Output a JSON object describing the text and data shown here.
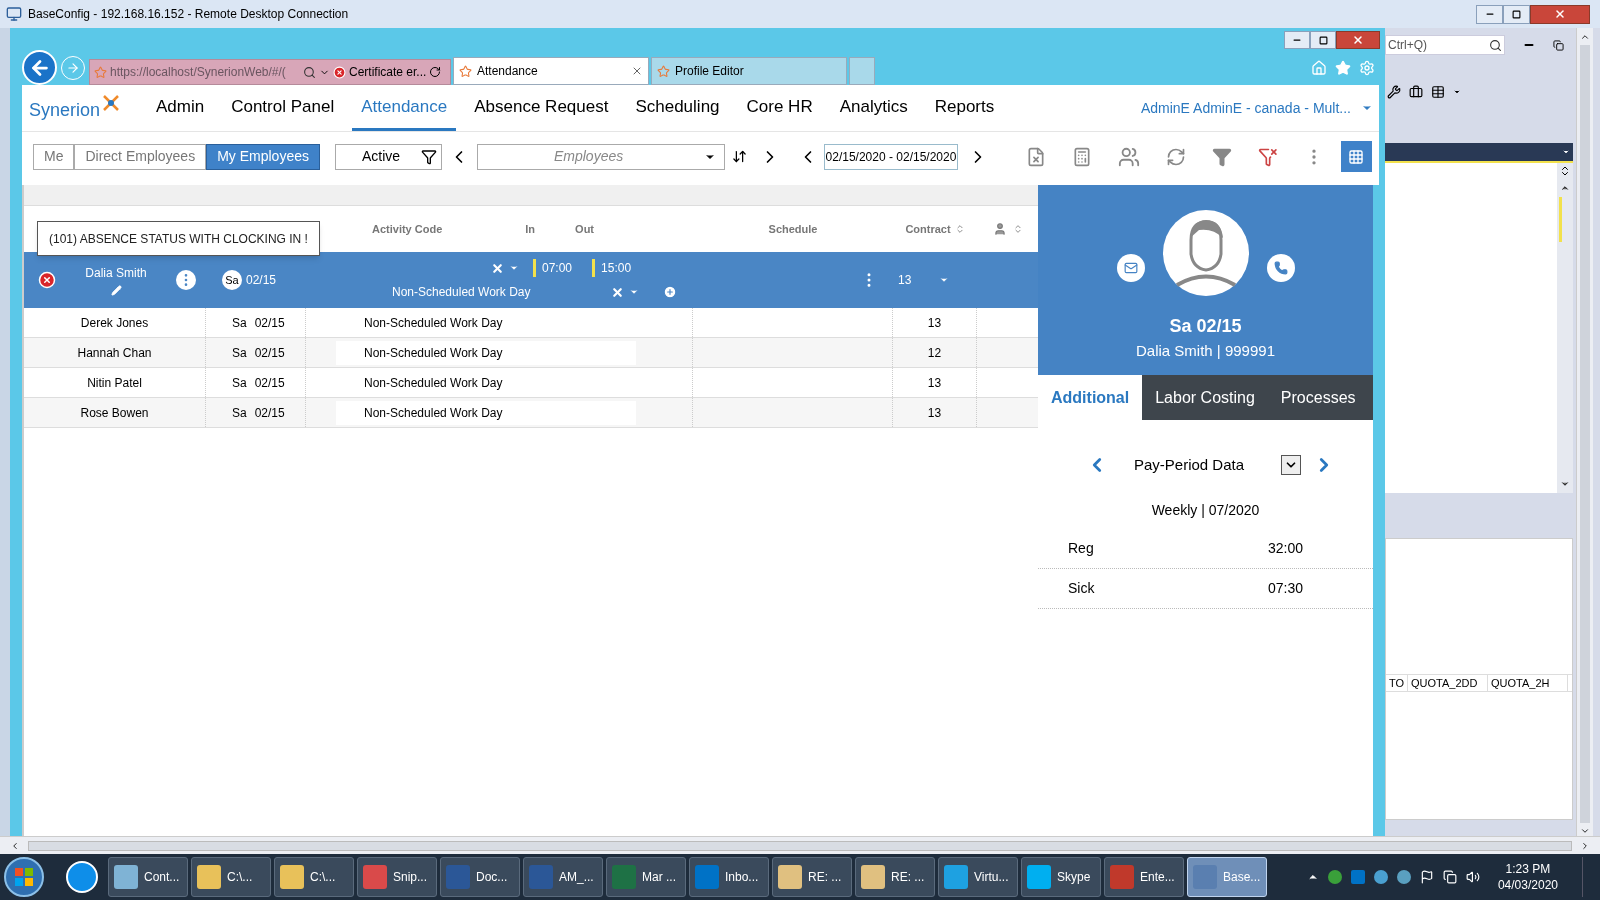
{
  "rdp": {
    "title": "BaseConfig - 192.168.16.152 - Remote Desktop Connection"
  },
  "browser": {
    "address": "https://localhost/SynerionWeb/#/(",
    "certificate": "Certificate er...",
    "tabs": [
      {
        "label": "Attendance",
        "selected": true
      },
      {
        "label": "Profile Editor",
        "selected": false
      }
    ]
  },
  "app": {
    "logo": "Synerion",
    "menu": [
      {
        "label": "Admin",
        "selected": false
      },
      {
        "label": "Control Panel",
        "selected": false
      },
      {
        "label": "Attendance",
        "selected": true
      },
      {
        "label": "Absence Request",
        "selected": false
      },
      {
        "label": "Scheduling",
        "selected": false
      },
      {
        "label": "Core HR",
        "selected": false
      },
      {
        "label": "Analytics",
        "selected": false
      },
      {
        "label": "Reports",
        "selected": false
      }
    ],
    "user": "AdminE AdminE - canada - Mult..."
  },
  "toolbar": {
    "scope": [
      {
        "label": "Me",
        "selected": false
      },
      {
        "label": "Direct Employees",
        "selected": false
      },
      {
        "label": "My Employees",
        "selected": true
      }
    ],
    "status": "Active",
    "employees_placeholder": "Employees",
    "date_range": "02/15/2020 - 02/15/2020"
  },
  "table": {
    "headers": {
      "activity": "Activity Code",
      "in": "In",
      "out": "Out",
      "schedule": "Schedule",
      "contract": "Contract"
    },
    "tooltip": "(101) ABSENCE STATUS WITH CLOCKING IN !",
    "rows": [
      {
        "name": "Dalia Smith",
        "day": "Sa",
        "date": "02/15",
        "activity": "Non-Scheduled Work Day",
        "in": "07:00",
        "out": "15:00",
        "contract": "13",
        "selected": true,
        "error": true
      },
      {
        "name": "Derek Jones",
        "day": "Sa",
        "date": "02/15",
        "activity": "Non-Scheduled Work Day",
        "contract": "13",
        "selected": false,
        "error": false
      },
      {
        "name": "Hannah Chan",
        "day": "Sa",
        "date": "02/15",
        "activity": "Non-Scheduled Work Day",
        "contract": "12",
        "selected": false,
        "error": false
      },
      {
        "name": "Nitin Patel",
        "day": "Sa",
        "date": "02/15",
        "activity": "Non-Scheduled Work Day",
        "contract": "13",
        "selected": false,
        "error": false
      },
      {
        "name": "Rose Bowen",
        "day": "Sa",
        "date": "02/15",
        "activity": "Non-Scheduled Work Day",
        "contract": "13",
        "selected": false,
        "error": false
      }
    ]
  },
  "details": {
    "date": "Sa 02/15",
    "employee": "Dalia Smith | 999991",
    "tabs": [
      {
        "label": "Additional",
        "selected": true
      },
      {
        "label": "Labor Costing",
        "selected": false
      },
      {
        "label": "Processes",
        "selected": false
      }
    ],
    "section": "Pay-Period Data",
    "period": "Weekly | 07/2020",
    "rows": [
      {
        "label": "Reg",
        "value": "32:00"
      },
      {
        "label": "Sick",
        "value": "07:30"
      }
    ]
  },
  "side_window": {
    "search": "Ctrl+Q)",
    "grid_columns": [
      "TO",
      "QUOTA_2DD",
      "QUOTA_2H"
    ]
  },
  "taskbar": {
    "items": [
      {
        "label": "Cont...",
        "color": "#7fb3d5",
        "selected": false
      },
      {
        "label": "C:\\...",
        "color": "#e8c15a",
        "selected": false
      },
      {
        "label": "C:\\...",
        "color": "#e8c15a",
        "selected": false
      },
      {
        "label": "Snip...",
        "color": "#d94a4a",
        "selected": false
      },
      {
        "label": "Doc...",
        "color": "#2b5797",
        "selected": false
      },
      {
        "label": "AM_...",
        "color": "#2b5797",
        "selected": false
      },
      {
        "label": "Mar ...",
        "color": "#1e7145",
        "selected": false
      },
      {
        "label": "Inbo...",
        "color": "#0072c6",
        "selected": false
      },
      {
        "label": "RE: ...",
        "color": "#e0c080",
        "selected": false
      },
      {
        "label": "RE: ...",
        "color": "#e0c080",
        "selected": false
      },
      {
        "label": "Virtu...",
        "color": "#1ea1e1",
        "selected": false
      },
      {
        "label": "Skype",
        "color": "#00aff0",
        "selected": false
      },
      {
        "label": "Ente...",
        "color": "#c0392b",
        "selected": false
      },
      {
        "label": "Base...",
        "color": "#5a7fb0",
        "selected": true
      }
    ],
    "time": "1:23 PM",
    "date": "04/03/2020"
  }
}
